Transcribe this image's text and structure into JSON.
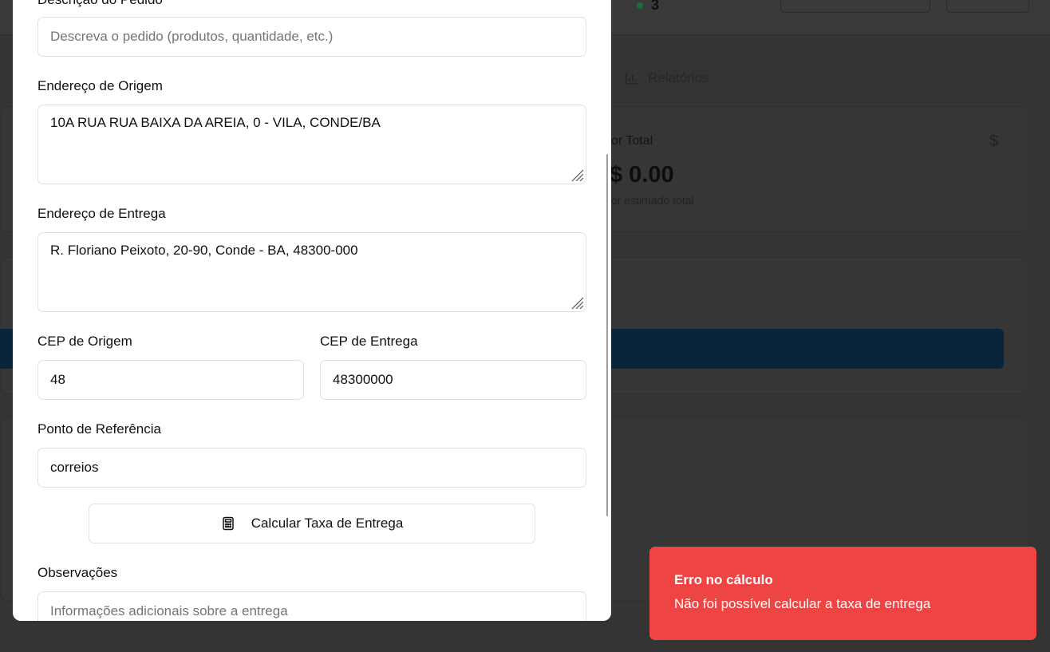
{
  "background": {
    "online_count": "3",
    "tab_reports": "Relatórios",
    "total_label": "or Total",
    "total_value": "$ 0.00",
    "total_sub": "or estimado total",
    "currency_icon": "$"
  },
  "modal": {
    "description": {
      "label": "Descrição do Pedido",
      "placeholder": "Descreva o pedido (produtos, quantidade, etc.)",
      "value": ""
    },
    "origin_address": {
      "label": "Endereço de Origem",
      "value": "10A RUA RUA BAIXA DA AREIA, 0 - VILA, CONDE/BA"
    },
    "delivery_address": {
      "label": "Endereço de Entrega",
      "value": "R. Floriano Peixoto, 20-90, Conde - BA, 48300-000"
    },
    "origin_cep": {
      "label": "CEP de Origem",
      "value": "48"
    },
    "delivery_cep": {
      "label": "CEP de Entrega",
      "value": "48300000"
    },
    "reference": {
      "label": "Ponto de Referência",
      "value": "correios"
    },
    "calculate_button": "Calcular Taxa de Entrega",
    "notes": {
      "label": "Observações",
      "placeholder": "Informações adicionais sobre a entrega"
    }
  },
  "toast": {
    "title": "Erro no cálculo",
    "message": "Não foi possível calcular a taxa de entrega",
    "color": "#ef4444"
  },
  "icons": {
    "calculator": "calculator-icon",
    "reports": "bar-chart-icon"
  }
}
